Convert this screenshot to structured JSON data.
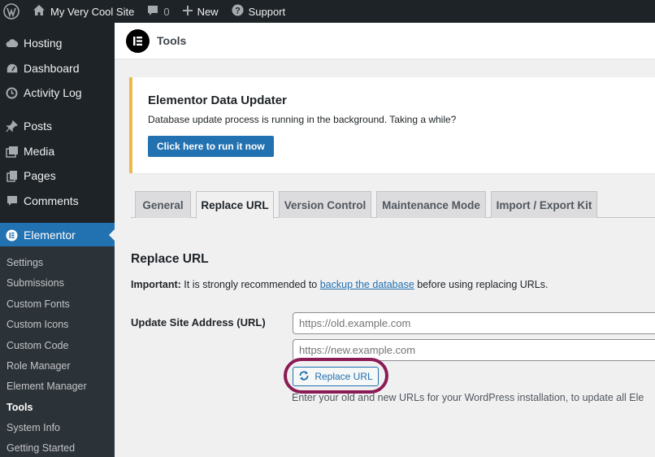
{
  "adminbar": {
    "wp_logo_icon": "wordpress-logo-icon",
    "site_name": "My Very Cool Site",
    "comments_count": "0",
    "new_label": "New",
    "support_label": "Support"
  },
  "sidebar": {
    "items": [
      {
        "label": "Hosting",
        "icon": "cloud-icon"
      },
      {
        "label": "Dashboard",
        "icon": "dashboard-icon"
      },
      {
        "label": "Activity Log",
        "icon": "history-icon"
      },
      {
        "label": "Posts",
        "icon": "pin-icon"
      },
      {
        "label": "Media",
        "icon": "media-icon"
      },
      {
        "label": "Pages",
        "icon": "pages-icon"
      },
      {
        "label": "Comments",
        "icon": "comment-icon"
      },
      {
        "label": "Elementor",
        "icon": "elementor-icon"
      }
    ],
    "submenu": [
      "Settings",
      "Submissions",
      "Custom Fonts",
      "Custom Icons",
      "Custom Code",
      "Role Manager",
      "Element Manager",
      "Tools",
      "System Info",
      "Getting Started"
    ]
  },
  "header": {
    "title": "Tools"
  },
  "notice": {
    "title": "Elementor Data Updater",
    "text": "Database update process is running in the background. Taking a while?",
    "button_label": "Click here to run it now"
  },
  "tabs": [
    "General",
    "Replace URL",
    "Version Control",
    "Maintenance Mode",
    "Import / Export Kit"
  ],
  "content": {
    "section_title": "Replace URL",
    "important_strong": "Important:",
    "important_text": " It is strongly recommended to ",
    "important_link": "backup the database",
    "important_rest": " before using replacing URLs.",
    "field_label": "Update Site Address (URL)",
    "old_url_placeholder": "https://old.example.com",
    "new_url_placeholder": "https://new.example.com",
    "button_label": "Replace URL",
    "description": "Enter your old and new URLs for your WordPress installation, to update all Ele"
  },
  "colors": {
    "accent": "#2271b1",
    "admin_dark": "#1d2327",
    "notice_border": "#f0b849",
    "highlight_ring": "#8b1b55"
  }
}
